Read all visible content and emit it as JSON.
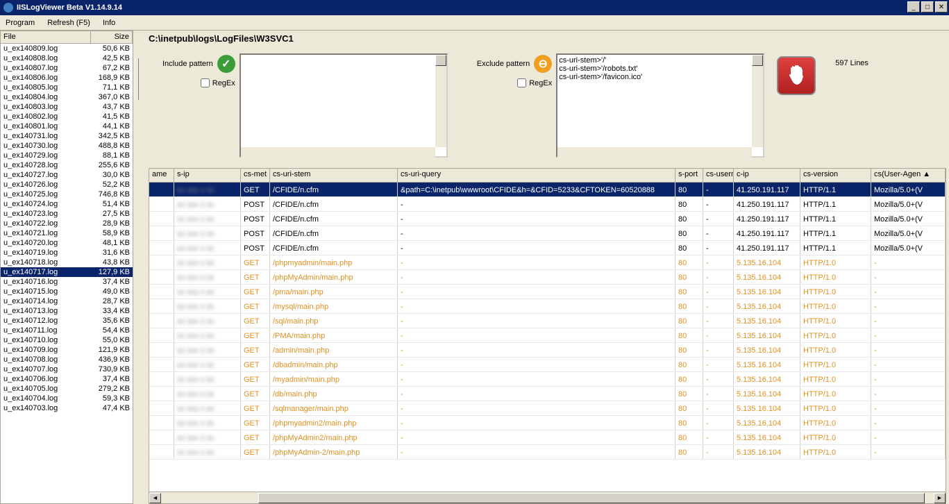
{
  "window": {
    "title": "IISLogViewer Beta V1.14.9.14"
  },
  "menu": {
    "program": "Program",
    "refresh": "Refresh (F5)",
    "info": "Info"
  },
  "filelist": {
    "headers": {
      "file": "File",
      "size": "Size"
    },
    "selected": "u_ex140717.log",
    "files": [
      {
        "n": "u_ex140809.log",
        "s": "50,6 KB"
      },
      {
        "n": "u_ex140808.log",
        "s": "42,5 KB"
      },
      {
        "n": "u_ex140807.log",
        "s": "67,2 KB"
      },
      {
        "n": "u_ex140806.log",
        "s": "168,9 KB"
      },
      {
        "n": "u_ex140805.log",
        "s": "71,1 KB"
      },
      {
        "n": "u_ex140804.log",
        "s": "367,0 KB"
      },
      {
        "n": "u_ex140803.log",
        "s": "43,7 KB"
      },
      {
        "n": "u_ex140802.log",
        "s": "41,5 KB"
      },
      {
        "n": "u_ex140801.log",
        "s": "44,1 KB"
      },
      {
        "n": "u_ex140731.log",
        "s": "342,5 KB"
      },
      {
        "n": "u_ex140730.log",
        "s": "488,8 KB"
      },
      {
        "n": "u_ex140729.log",
        "s": "88,1 KB"
      },
      {
        "n": "u_ex140728.log",
        "s": "255,6 KB"
      },
      {
        "n": "u_ex140727.log",
        "s": "30,0 KB"
      },
      {
        "n": "u_ex140726.log",
        "s": "52,2 KB"
      },
      {
        "n": "u_ex140725.log",
        "s": "746,8 KB"
      },
      {
        "n": "u_ex140724.log",
        "s": "51,4 KB"
      },
      {
        "n": "u_ex140723.log",
        "s": "27,5 KB"
      },
      {
        "n": "u_ex140722.log",
        "s": "28,9 KB"
      },
      {
        "n": "u_ex140721.log",
        "s": "58,9 KB"
      },
      {
        "n": "u_ex140720.log",
        "s": "48,1 KB"
      },
      {
        "n": "u_ex140719.log",
        "s": "31,6 KB"
      },
      {
        "n": "u_ex140718.log",
        "s": "43,8 KB"
      },
      {
        "n": "u_ex140717.log",
        "s": "127,9 KB"
      },
      {
        "n": "u_ex140716.log",
        "s": "37,4 KB"
      },
      {
        "n": "u_ex140715.log",
        "s": "49,0 KB"
      },
      {
        "n": "u_ex140714.log",
        "s": "28,7 KB"
      },
      {
        "n": "u_ex140713.log",
        "s": "33,4 KB"
      },
      {
        "n": "u_ex140712.log",
        "s": "35,6 KB"
      },
      {
        "n": "u_ex140711.log",
        "s": "54,4 KB"
      },
      {
        "n": "u_ex140710.log",
        "s": "55,0 KB"
      },
      {
        "n": "u_ex140709.log",
        "s": "121,9 KB"
      },
      {
        "n": "u_ex140708.log",
        "s": "436,9 KB"
      },
      {
        "n": "u_ex140707.log",
        "s": "730,9 KB"
      },
      {
        "n": "u_ex140706.log",
        "s": "37,4 KB"
      },
      {
        "n": "u_ex140705.log",
        "s": "279,2 KB"
      },
      {
        "n": "u_ex140704.log",
        "s": "59,3 KB"
      },
      {
        "n": "u_ex140703.log",
        "s": "47,4 KB"
      }
    ]
  },
  "path": "C:\\inetpub\\logs\\LogFiles\\W3SVC1",
  "include": {
    "label": "Include pattern",
    "regex": "RegEx",
    "value": ""
  },
  "exclude": {
    "label": "Exclude pattern",
    "regex": "RegEx",
    "value": "cs-uri-stem>'/'\ncs-uri-stem>'/robots.txt'\ncs-uri-stem>'/favicon.ico'"
  },
  "lines": "597 Lines",
  "grid": {
    "headers": {
      "ame": "ame",
      "sip": "s-ip",
      "met": "cs-met",
      "stem": "cs-uri-stem",
      "query": "cs-uri-query",
      "port": "s-port",
      "user": "cs-usern",
      "cip": "c-ip",
      "ver": "cs-version",
      "ua": "cs(User-Agen"
    },
    "rows": [
      {
        "met": "GET",
        "stem": "/CFIDE/n.cfm",
        "query": "&path=C:\\inetpub\\wwwroot\\CFIDE&h=&CFID=5233&CFTOKEN=60520888",
        "port": "80",
        "user": "-",
        "cip": "41.250.191.117",
        "ver": "HTTP/1.1",
        "ua": "Mozilla/5.0+(V",
        "sel": true,
        "orange": false
      },
      {
        "met": "POST",
        "stem": "/CFIDE/n.cfm",
        "query": "-",
        "port": "80",
        "user": "-",
        "cip": "41.250.191.117",
        "ver": "HTTP/1.1",
        "ua": "Mozilla/5.0+(V",
        "orange": false
      },
      {
        "met": "POST",
        "stem": "/CFIDE/n.cfm",
        "query": "-",
        "port": "80",
        "user": "-",
        "cip": "41.250.191.117",
        "ver": "HTTP/1.1",
        "ua": "Mozilla/5.0+(V",
        "orange": false
      },
      {
        "met": "POST",
        "stem": "/CFIDE/n.cfm",
        "query": "-",
        "port": "80",
        "user": "-",
        "cip": "41.250.191.117",
        "ver": "HTTP/1.1",
        "ua": "Mozilla/5.0+(V",
        "orange": false
      },
      {
        "met": "POST",
        "stem": "/CFIDE/n.cfm",
        "query": "-",
        "port": "80",
        "user": "-",
        "cip": "41.250.191.117",
        "ver": "HTTP/1.1",
        "ua": "Mozilla/5.0+(V",
        "orange": false
      },
      {
        "met": "GET",
        "stem": "/phpmyadmin/main.php",
        "query": "-",
        "port": "80",
        "user": "-",
        "cip": "5.135.16.104",
        "ver": "HTTP/1.0",
        "ua": "-",
        "orange": true
      },
      {
        "met": "GET",
        "stem": "/phpMyAdmin/main.php",
        "query": "-",
        "port": "80",
        "user": "-",
        "cip": "5.135.16.104",
        "ver": "HTTP/1.0",
        "ua": "-",
        "orange": true
      },
      {
        "met": "GET",
        "stem": "/pma/main.php",
        "query": "-",
        "port": "80",
        "user": "-",
        "cip": "5.135.16.104",
        "ver": "HTTP/1.0",
        "ua": "-",
        "orange": true
      },
      {
        "met": "GET",
        "stem": "/mysql/main.php",
        "query": "-",
        "port": "80",
        "user": "-",
        "cip": "5.135.16.104",
        "ver": "HTTP/1.0",
        "ua": "-",
        "orange": true
      },
      {
        "met": "GET",
        "stem": "/sql/main.php",
        "query": "-",
        "port": "80",
        "user": "-",
        "cip": "5.135.16.104",
        "ver": "HTTP/1.0",
        "ua": "-",
        "orange": true
      },
      {
        "met": "GET",
        "stem": "/PMA/main.php",
        "query": "-",
        "port": "80",
        "user": "-",
        "cip": "5.135.16.104",
        "ver": "HTTP/1.0",
        "ua": "-",
        "orange": true
      },
      {
        "met": "GET",
        "stem": "/admin/main.php",
        "query": "-",
        "port": "80",
        "user": "-",
        "cip": "5.135.16.104",
        "ver": "HTTP/1.0",
        "ua": "-",
        "orange": true
      },
      {
        "met": "GET",
        "stem": "/dbadmin/main.php",
        "query": "-",
        "port": "80",
        "user": "-",
        "cip": "5.135.16.104",
        "ver": "HTTP/1.0",
        "ua": "-",
        "orange": true
      },
      {
        "met": "GET",
        "stem": "/myadmin/main.php",
        "query": "-",
        "port": "80",
        "user": "-",
        "cip": "5.135.16.104",
        "ver": "HTTP/1.0",
        "ua": "-",
        "orange": true
      },
      {
        "met": "GET",
        "stem": "/db/main.php",
        "query": "-",
        "port": "80",
        "user": "-",
        "cip": "5.135.16.104",
        "ver": "HTTP/1.0",
        "ua": "-",
        "orange": true
      },
      {
        "met": "GET",
        "stem": "/sqlmanager/main.php",
        "query": "-",
        "port": "80",
        "user": "-",
        "cip": "5.135.16.104",
        "ver": "HTTP/1.0",
        "ua": "-",
        "orange": true
      },
      {
        "met": "GET",
        "stem": "/phpmyadmin2/main.php",
        "query": "-",
        "port": "80",
        "user": "-",
        "cip": "5.135.16.104",
        "ver": "HTTP/1.0",
        "ua": "-",
        "orange": true
      },
      {
        "met": "GET",
        "stem": "/phpMyAdmin2/main.php",
        "query": "-",
        "port": "80",
        "user": "-",
        "cip": "5.135.16.104",
        "ver": "HTTP/1.0",
        "ua": "-",
        "orange": true
      },
      {
        "met": "GET",
        "stem": "/phpMyAdmin-2/main.php",
        "query": "-",
        "port": "80",
        "user": "-",
        "cip": "5.135.16.104",
        "ver": "HTTP/1.0",
        "ua": "-",
        "orange": true
      }
    ]
  }
}
